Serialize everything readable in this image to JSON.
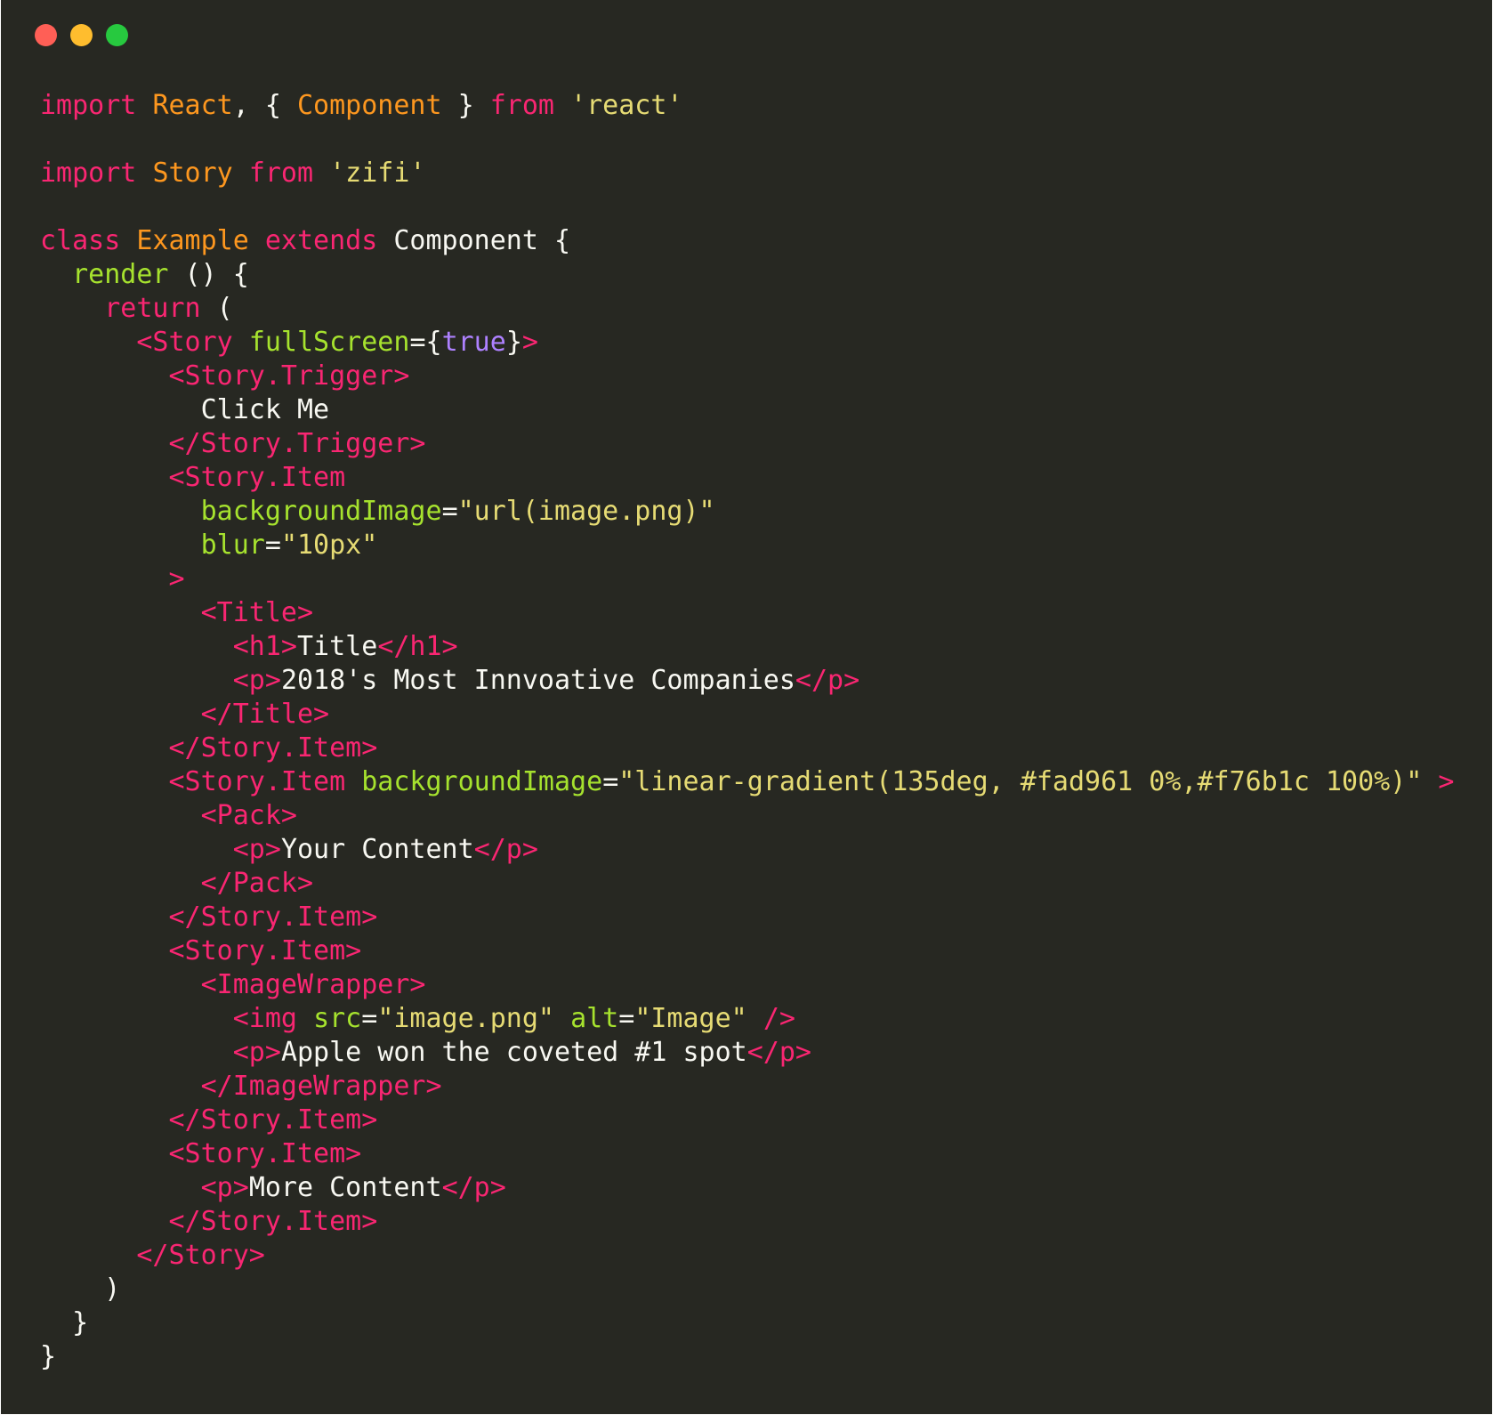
{
  "window": {
    "controls": [
      {
        "name": "close",
        "color": "#ff5f56"
      },
      {
        "name": "minimize",
        "color": "#ffbd2e"
      },
      {
        "name": "maximize",
        "color": "#27c93f"
      }
    ]
  },
  "theme": {
    "background": "#272822",
    "keyword": "#f92672",
    "tag": "#f92672",
    "class_name": "#fd971f",
    "attribute": "#a6e22e",
    "string": "#e6db74",
    "boolean": "#ae81ff",
    "plain": "#f8f8f2"
  },
  "code": {
    "lines": [
      [
        [
          "k",
          "import"
        ],
        [
          "p",
          " "
        ],
        [
          "c",
          "React"
        ],
        [
          "p",
          ", { "
        ],
        [
          "c",
          "Component"
        ],
        [
          "p",
          " } "
        ],
        [
          "k",
          "from"
        ],
        [
          "p",
          " "
        ],
        [
          "s",
          "'react'"
        ]
      ],
      [],
      [
        [
          "k",
          "import"
        ],
        [
          "p",
          " "
        ],
        [
          "c",
          "Story"
        ],
        [
          "p",
          " "
        ],
        [
          "k",
          "from"
        ],
        [
          "p",
          " "
        ],
        [
          "s",
          "'zifi'"
        ]
      ],
      [],
      [
        [
          "k",
          "class"
        ],
        [
          "p",
          " "
        ],
        [
          "c",
          "Example"
        ],
        [
          "p",
          " "
        ],
        [
          "k",
          "extends"
        ],
        [
          "p",
          " Component {"
        ]
      ],
      [
        [
          "p",
          "  "
        ],
        [
          "f",
          "render"
        ],
        [
          "p",
          " () {"
        ]
      ],
      [
        [
          "p",
          "    "
        ],
        [
          "k",
          "return"
        ],
        [
          "p",
          " ("
        ]
      ],
      [
        [
          "p",
          "      "
        ],
        [
          "t",
          "<Story"
        ],
        [
          "p",
          " "
        ],
        [
          "a",
          "fullScreen"
        ],
        [
          "p",
          "={"
        ],
        [
          "b",
          "true"
        ],
        [
          "p",
          "}"
        ],
        [
          "t",
          ">"
        ]
      ],
      [
        [
          "p",
          "        "
        ],
        [
          "t",
          "<Story.Trigger>"
        ]
      ],
      [
        [
          "x",
          "          Click Me"
        ]
      ],
      [
        [
          "p",
          "        "
        ],
        [
          "t",
          "</Story.Trigger>"
        ]
      ],
      [
        [
          "p",
          "        "
        ],
        [
          "t",
          "<Story.Item"
        ]
      ],
      [
        [
          "p",
          "          "
        ],
        [
          "a",
          "backgroundImage"
        ],
        [
          "p",
          "="
        ],
        [
          "s",
          "\"url(image.png)\""
        ]
      ],
      [
        [
          "p",
          "          "
        ],
        [
          "a",
          "blur"
        ],
        [
          "p",
          "="
        ],
        [
          "s",
          "\"10px\""
        ]
      ],
      [
        [
          "p",
          "        "
        ],
        [
          "t",
          ">"
        ]
      ],
      [
        [
          "p",
          "          "
        ],
        [
          "t",
          "<Title>"
        ]
      ],
      [
        [
          "p",
          "            "
        ],
        [
          "t",
          "<h1>"
        ],
        [
          "x",
          "Title"
        ],
        [
          "t",
          "</h1>"
        ]
      ],
      [
        [
          "p",
          "            "
        ],
        [
          "t",
          "<p>"
        ],
        [
          "x",
          "2018's Most Innvoative Companies"
        ],
        [
          "t",
          "</p>"
        ]
      ],
      [
        [
          "p",
          "          "
        ],
        [
          "t",
          "</Title>"
        ]
      ],
      [
        [
          "p",
          "        "
        ],
        [
          "t",
          "</Story.Item>"
        ]
      ],
      [
        [
          "p",
          "        "
        ],
        [
          "t",
          "<Story.Item"
        ],
        [
          "p",
          " "
        ],
        [
          "a",
          "backgroundImage"
        ],
        [
          "p",
          "="
        ],
        [
          "s",
          "\"linear-gradient(135deg, #fad961 0%,#f76b1c 100%)\""
        ],
        [
          "p",
          " "
        ],
        [
          "t",
          ">"
        ]
      ],
      [
        [
          "p",
          "          "
        ],
        [
          "t",
          "<Pack>"
        ]
      ],
      [
        [
          "p",
          "            "
        ],
        [
          "t",
          "<p>"
        ],
        [
          "x",
          "Your Content"
        ],
        [
          "t",
          "</p>"
        ]
      ],
      [
        [
          "p",
          "          "
        ],
        [
          "t",
          "</Pack>"
        ]
      ],
      [
        [
          "p",
          "        "
        ],
        [
          "t",
          "</Story.Item>"
        ]
      ],
      [
        [
          "p",
          "        "
        ],
        [
          "t",
          "<Story.Item>"
        ]
      ],
      [
        [
          "p",
          "          "
        ],
        [
          "t",
          "<ImageWrapper>"
        ]
      ],
      [
        [
          "p",
          "            "
        ],
        [
          "t",
          "<img"
        ],
        [
          "p",
          " "
        ],
        [
          "a",
          "src"
        ],
        [
          "p",
          "="
        ],
        [
          "s",
          "\"image.png\""
        ],
        [
          "p",
          " "
        ],
        [
          "a",
          "alt"
        ],
        [
          "p",
          "="
        ],
        [
          "s",
          "\"Image\""
        ],
        [
          "p",
          " "
        ],
        [
          "t",
          "/>"
        ]
      ],
      [
        [
          "p",
          "            "
        ],
        [
          "t",
          "<p>"
        ],
        [
          "x",
          "Apple won the coveted #1 spot"
        ],
        [
          "t",
          "</p>"
        ]
      ],
      [
        [
          "p",
          "          "
        ],
        [
          "t",
          "</ImageWrapper>"
        ]
      ],
      [
        [
          "p",
          "        "
        ],
        [
          "t",
          "</Story.Item>"
        ]
      ],
      [
        [
          "p",
          "        "
        ],
        [
          "t",
          "<Story.Item>"
        ]
      ],
      [
        [
          "p",
          "          "
        ],
        [
          "t",
          "<p>"
        ],
        [
          "x",
          "More Content"
        ],
        [
          "t",
          "</p>"
        ]
      ],
      [
        [
          "p",
          "        "
        ],
        [
          "t",
          "</Story.Item>"
        ]
      ],
      [
        [
          "p",
          "      "
        ],
        [
          "t",
          "</Story>"
        ]
      ],
      [
        [
          "p",
          "    )"
        ]
      ],
      [
        [
          "p",
          "  }"
        ]
      ],
      [
        [
          "p",
          "}"
        ]
      ]
    ]
  }
}
